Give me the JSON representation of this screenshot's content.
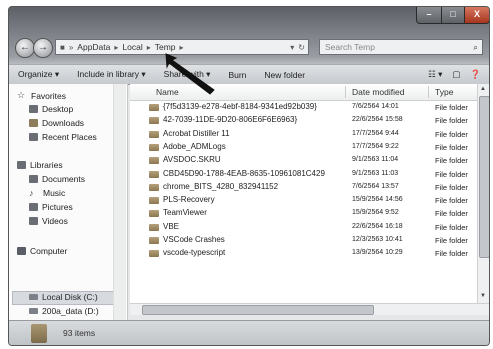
{
  "window": {
    "buttons": {
      "minimize": "–",
      "maximize": "□",
      "close": "X"
    }
  },
  "nav": {
    "back": "←",
    "forward": "→",
    "breadcrumb": [
      "AppData",
      "Local",
      "Temp"
    ],
    "search_placeholder": "Search Temp"
  },
  "toolbar": {
    "organize": "Organize ▾",
    "include": "Include in library ▾",
    "share": "Share with ▾",
    "burn": "Burn",
    "new_folder": "New folder"
  },
  "sidebar": {
    "favorites": "Favorites",
    "desktop": "Desktop",
    "downloads": "Downloads",
    "recent": "Recent Places",
    "libraries": "Libraries",
    "documents": "Documents",
    "music": "Music",
    "pictures": "Pictures",
    "videos": "Videos",
    "computer": "Computer",
    "local_disk": "Local Disk (C:)",
    "data_disk": "200a_data (D:)"
  },
  "columns": {
    "name": "Name",
    "date": "Date modified",
    "type": "Type"
  },
  "files": [
    {
      "name": "{7f5d3139-e278-4ebf-8184-9341ed92b039}",
      "date": "7/6/2564 14:01",
      "type": "File folder"
    },
    {
      "name": "42-7039-11DE-9D20-806E6F6E6963}",
      "date": "22/6/2564 15:58",
      "type": "File folder"
    },
    {
      "name": "Acrobat Distiller 11",
      "date": "17/7/2564 9:44",
      "type": "File folder"
    },
    {
      "name": "Adobe_ADMLogs",
      "date": "17/7/2564 9:22",
      "type": "File folder"
    },
    {
      "name": "AVSDOC.SKRU",
      "date": "9/1/2563 11:04",
      "type": "File folder"
    },
    {
      "name": "CBD45D90-1788-4EAB-8635-10961081C429",
      "date": "9/1/2563 11:03",
      "type": "File folder"
    },
    {
      "name": "chrome_BITS_4280_832941152",
      "date": "7/6/2564 13:57",
      "type": "File folder"
    },
    {
      "name": "PLS-Recovery",
      "date": "15/9/2564 14:56",
      "type": "File folder"
    },
    {
      "name": "TeamViewer",
      "date": "15/9/2564 9:52",
      "type": "File folder"
    },
    {
      "name": "VBE",
      "date": "22/6/2564 16:18",
      "type": "File folder"
    },
    {
      "name": "VSCode Crashes",
      "date": "12/3/2563 10:41",
      "type": "File folder"
    },
    {
      "name": "vscode-typescript",
      "date": "13/9/2564 10:29",
      "type": "File folder"
    }
  ],
  "status": {
    "count": "93 items"
  }
}
